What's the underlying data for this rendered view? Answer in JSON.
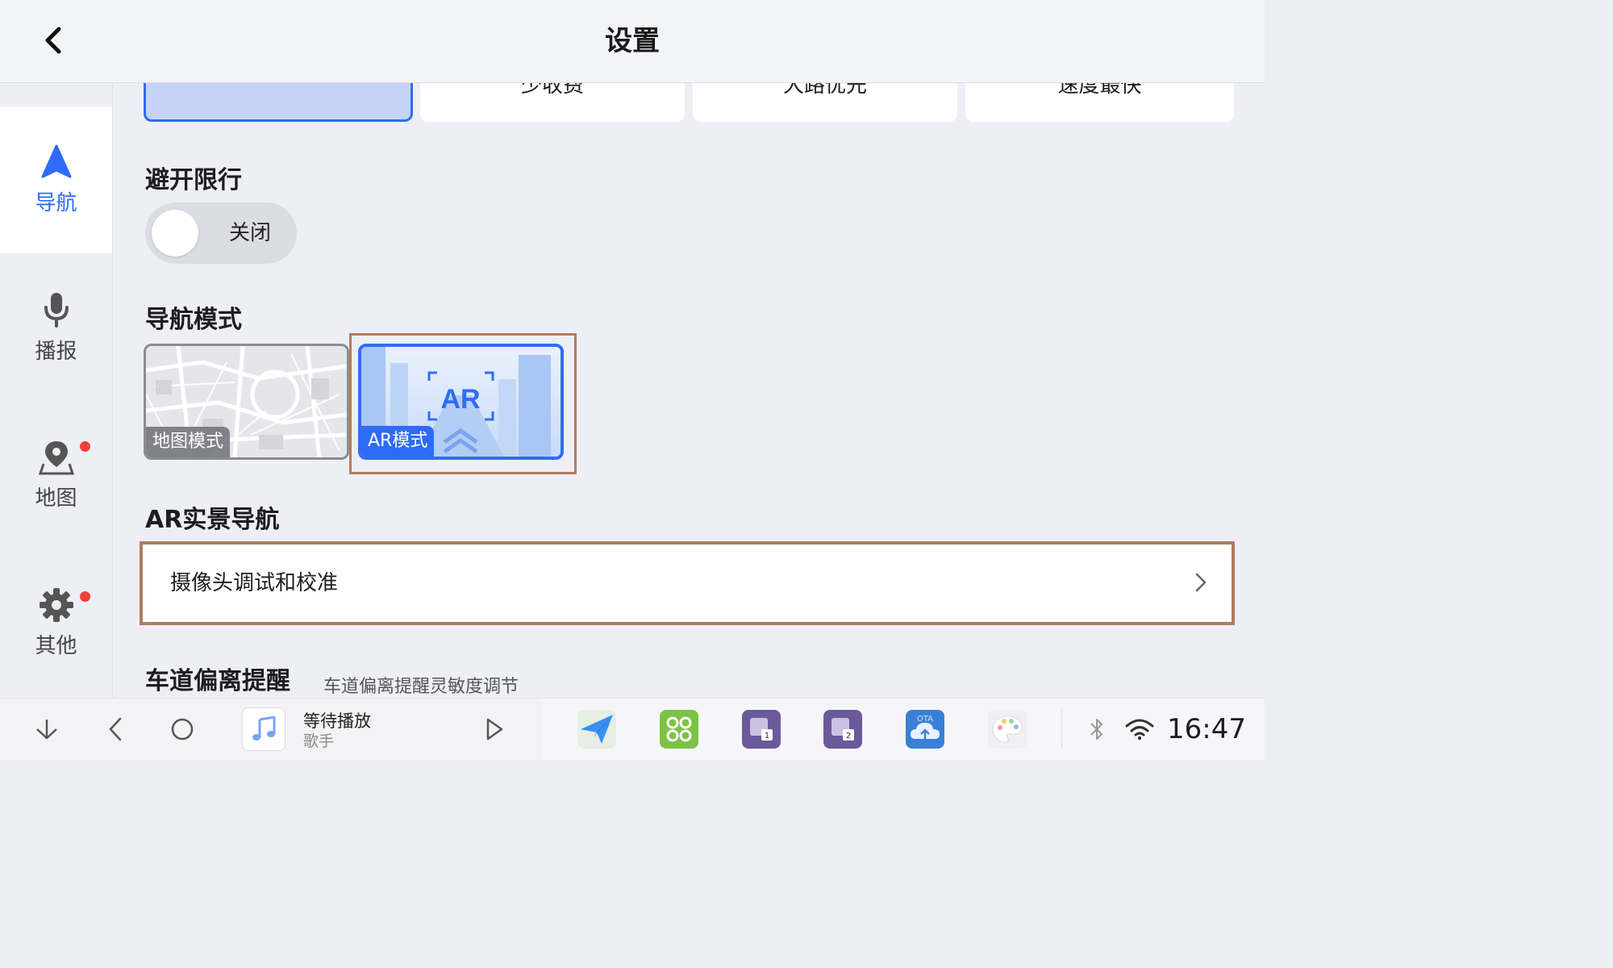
{
  "header": {
    "title": "设置"
  },
  "sidebar": {
    "items": [
      {
        "label": "导航",
        "icon": "navigation-arrow-icon",
        "active": true,
        "badge": false
      },
      {
        "label": "播报",
        "icon": "microphone-icon",
        "active": false,
        "badge": false
      },
      {
        "label": "地图",
        "icon": "map-pin-icon",
        "active": false,
        "badge": true
      },
      {
        "label": "其他",
        "icon": "gear-icon",
        "active": false,
        "badge": true
      }
    ]
  },
  "route_preferences": {
    "options": [
      "",
      "少收费",
      "大路优先",
      "速度最快"
    ],
    "selected_index": 0
  },
  "avoid_restriction": {
    "title": "避开限行",
    "toggle_label": "关闭",
    "enabled": false
  },
  "nav_mode": {
    "title": "导航模式",
    "modes": [
      {
        "label": "地图模式",
        "selected": false
      },
      {
        "label": "AR模式",
        "badge_text": "AR",
        "selected": true
      }
    ]
  },
  "ar_nav": {
    "title": "AR实景导航",
    "camera_row_label": "摄像头调试和校准"
  },
  "lane_departure": {
    "title": "车道偏离提醒",
    "subtitle": "车道偏离提醒灵敏度调节"
  },
  "taskbar": {
    "music_title": "等待播放",
    "music_artist": "歌手",
    "clock": "16:47",
    "apps": [
      "paper-plane-app-icon",
      "apps-grid-app-icon",
      "window-1-app-icon",
      "window-2-app-icon",
      "ota-cloud-app-icon",
      "palette-app-icon"
    ],
    "ota_text": "OTA",
    "window_numbers": [
      "1",
      "2"
    ]
  },
  "colors": {
    "accent": "#2f6cf6",
    "highlight_border": "#b17c5d",
    "badge_red": "#f0413c",
    "background": "#eeeff6"
  }
}
